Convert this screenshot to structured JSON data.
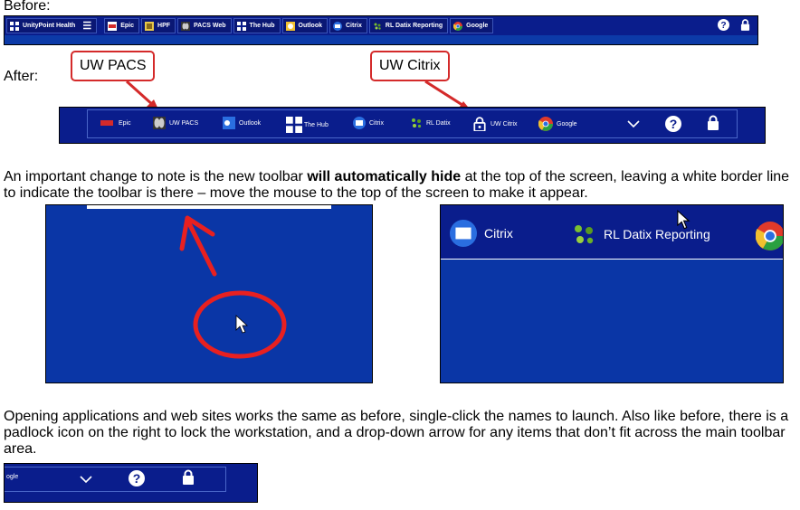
{
  "labels": {
    "before": "Before:",
    "after": "After:"
  },
  "before_toolbar": {
    "items": [
      {
        "label": "UnityPoint Health",
        "icon": "unitypoint-logo-icon"
      },
      {
        "label": "Epic",
        "icon": "epic-icon"
      },
      {
        "label": "HPF",
        "icon": "hpf-icon"
      },
      {
        "label": "PACS Web",
        "icon": "pacs-icon"
      },
      {
        "label": "The Hub",
        "icon": "hub-icon"
      },
      {
        "label": "Outlook",
        "icon": "outlook-icon"
      },
      {
        "label": "Citrix",
        "icon": "citrix-icon"
      },
      {
        "label": "RL Datix Reporting",
        "icon": "datix-icon"
      },
      {
        "label": "Google",
        "icon": "chrome-icon"
      }
    ],
    "help_glyph": "?"
  },
  "after_toolbar": {
    "items": [
      {
        "label": "Epic",
        "icon": "epic-icon"
      },
      {
        "label": "UW PACS",
        "icon": "pacs-icon"
      },
      {
        "label": "Outlook",
        "icon": "outlook-icon"
      },
      {
        "label": "The Hub",
        "icon": "hub-icon"
      },
      {
        "label": "Citrix",
        "icon": "citrix-icon"
      },
      {
        "label": "RL Datix",
        "icon": "datix-icon"
      },
      {
        "label": "UW Citrix",
        "icon": "lock-app-icon"
      },
      {
        "label": "Google",
        "icon": "chrome-icon"
      }
    ],
    "help_glyph": "?"
  },
  "callouts": {
    "pacs": "UW PACS",
    "citrix": "UW Citrix"
  },
  "paragraph1": {
    "part1": "An important change to note is the new toolbar ",
    "bold": "will automatically hide",
    "part2": " at the top of the screen, leaving a white border line to indicate the toolbar is there – move the mouse to the top of the screen to make it appear."
  },
  "right_shot": {
    "citrix": "Citrix",
    "datix": "RL Datix Reporting"
  },
  "paragraph2": "Opening applications and web sites works the same as before, single-click the names to launch. Also like before, there is a padlock icon on the right to lock the workstation, and a drop-down arrow for any items that don’t fit across the main toolbar area.",
  "bottom_toolbar": {
    "partial_label": "ogle",
    "help_glyph": "?"
  },
  "colors": {
    "toolbar": "#0a1d8c",
    "screen": "#0a36a6",
    "callout_red": "#d42a2a"
  }
}
